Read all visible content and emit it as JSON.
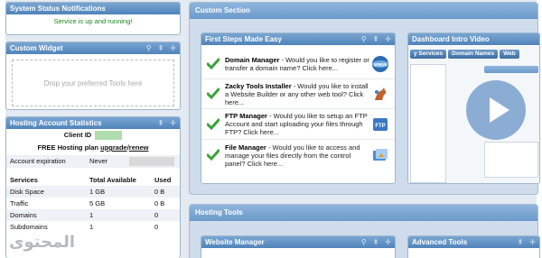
{
  "left": {
    "status": {
      "title": "System Status Notifications",
      "message": "Service is up and running!"
    },
    "widget": {
      "title": "Custom Widget",
      "drop_text": "Drop your preferred Tools here"
    },
    "stats": {
      "title": "Hosting Account Statistics",
      "client_id_label": "Client ID",
      "free_prefix": "FREE Hosting plan ",
      "upgrade_link": "upgrade",
      "slash": "/",
      "renew_link": "renew",
      "expiration_label": "Account expiration",
      "expiration_value": "Never",
      "columns": [
        "Services",
        "Total Available",
        "Used"
      ],
      "rows": [
        [
          "Disk Space",
          "1 GB",
          "0 B"
        ],
        [
          "Traffic",
          "5 GB",
          "0 B"
        ],
        [
          "Domains",
          "1",
          "0"
        ],
        [
          "Subdomains",
          "1",
          "0"
        ]
      ]
    }
  },
  "custom_section": {
    "title": "Custom Section",
    "first_steps": {
      "title": "First Steps Made Easy",
      "items": [
        {
          "bold": "Domain Manager",
          "text": " - Would you like to register or transfer a domain name? Click here...",
          "icon_color": "#2b6cb0",
          "icon": "www-globe-icon"
        },
        {
          "bold": "Zacky Tools Installer",
          "text": " - Would you like to install a Website Builder or any other web tool? Click here...",
          "icon_color": "#c0622a",
          "icon": "kangaroo-icon"
        },
        {
          "bold": "FTP Manager",
          "text": " - Would you like to setup an FTP Account and start uploading your files through FTP? Click here...",
          "icon_color": "#3a78c2",
          "icon": "ftp-icon"
        },
        {
          "bold": "File Manager",
          "text": " - Would you like to access and manage your files directly from the control panel? Click here...",
          "icon_color": "#4a8fd6",
          "icon": "file-manager-icon"
        }
      ]
    },
    "dashboard_video": {
      "title": "Dashboard Intro Video",
      "tabs": [
        "y Services",
        "Domain Names",
        "Web"
      ]
    }
  },
  "hosting_tools": {
    "title": "Hosting Tools",
    "website_manager": "Website Manager",
    "advanced_tools": "Advanced Tools"
  },
  "watermark": "المحتوى",
  "colors": {
    "header_blue": "#5f8fc4",
    "status_green": "#1a8a1a",
    "section_bg": "#cfdceb"
  }
}
